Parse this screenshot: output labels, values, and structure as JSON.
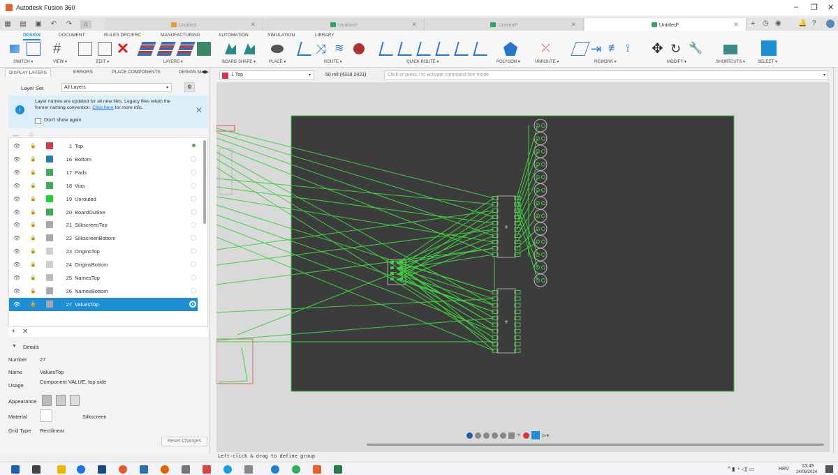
{
  "window": {
    "title": "Autodesk Fusion 360"
  },
  "tabs": [
    {
      "label": "Untitled",
      "active": false,
      "color": "#e89b2d"
    },
    {
      "label": "Untitled*",
      "active": false,
      "color": "#2ea36b"
    },
    {
      "label": "Untitled*",
      "active": false,
      "color": "#2ea36b"
    },
    {
      "label": "Untitled*",
      "active": true,
      "color": "#2ea36b"
    }
  ],
  "ribbon": {
    "tabs": [
      "DESIGN",
      "DOCUMENT",
      "RULES DRC/ERC",
      "MANUFACTURING",
      "AUTOMATION",
      "SIMULATION",
      "LIBRARY"
    ],
    "groups": [
      "SWITCH ▾",
      "VIEW ▾",
      "EDIT ▾",
      "LAYERS ▾",
      "BOARD SHAPE ▾",
      "PLACE ▾",
      "ROUTE ▾",
      "QUICK ROUTE ▾",
      "POLYGON ▾",
      "UNROUTE ▾",
      "REWORK ▾",
      "MODIFY ▾",
      "SHORTCUTS ▾",
      "SELECT ▾"
    ]
  },
  "panel": {
    "tabs": [
      "DISPLAY LAYERS",
      "ERRORS",
      "PLACE COMPONENTS",
      "DESIGN M"
    ],
    "layerset_label": "Layer Set",
    "layerset_value": "All Layers",
    "notice_text": "Layer names are updated for all new files. Legacy files retain the former naming convention.",
    "notice_link": "Click here",
    "notice_tail": "for more info.",
    "dont_show": "Don't show again",
    "layers": [
      {
        "num": "1",
        "name": "Top",
        "color": "#d03a4a",
        "active": true
      },
      {
        "num": "16",
        "name": "Bottom",
        "color": "#1f7fb5"
      },
      {
        "num": "17",
        "name": "Pads",
        "color": "#3faa5a"
      },
      {
        "num": "18",
        "name": "Vias",
        "color": "#3faa5a"
      },
      {
        "num": "19",
        "name": "Unrouted",
        "color": "#22cc33"
      },
      {
        "num": "20",
        "name": "BoardOutline",
        "color": "#3faa5a"
      },
      {
        "num": "21",
        "name": "SilkscreenTop",
        "color": "#a8a8a8"
      },
      {
        "num": "22",
        "name": "SilkscreenBottom",
        "color": "#a8a8a8"
      },
      {
        "num": "23",
        "name": "OriginsTop",
        "color": "#cfcfcf"
      },
      {
        "num": "24",
        "name": "OriginsBottom",
        "color": "#cfcfcf"
      },
      {
        "num": "25",
        "name": "NamesTop",
        "color": "#bdbdbd"
      },
      {
        "num": "26",
        "name": "NamesBottom",
        "color": "#a8a8a8"
      },
      {
        "num": "27",
        "name": "ValuesTop",
        "color": "#a8a8a8",
        "selected": true
      }
    ],
    "details_title": "Details",
    "details": {
      "number_label": "Number",
      "number": "27",
      "name_label": "Name",
      "name": "ValuesTop",
      "usage_label": "Usage",
      "usage": "Component VALUE, top side",
      "appearance_label": "Appearance",
      "material_label": "Material",
      "material": "Silkscreen",
      "gridtype_label": "Grid Type",
      "gridtype": "Rectilinear"
    },
    "reset_label": "Reset Changes"
  },
  "canvasbar": {
    "layer": "1 Top",
    "grid": "50 mil (4318 2421)",
    "command_placeholder": "Click or press / to activate command line mode"
  },
  "status": {
    "text": "Left-click & drag to define group"
  },
  "taskbar": {
    "lang": "HRV",
    "time": "13:45",
    "date": "24/09/2024"
  },
  "colors": {
    "accent": "#1e8fd6",
    "board": "#3c3c3c",
    "airwire": "#3fd13f"
  }
}
